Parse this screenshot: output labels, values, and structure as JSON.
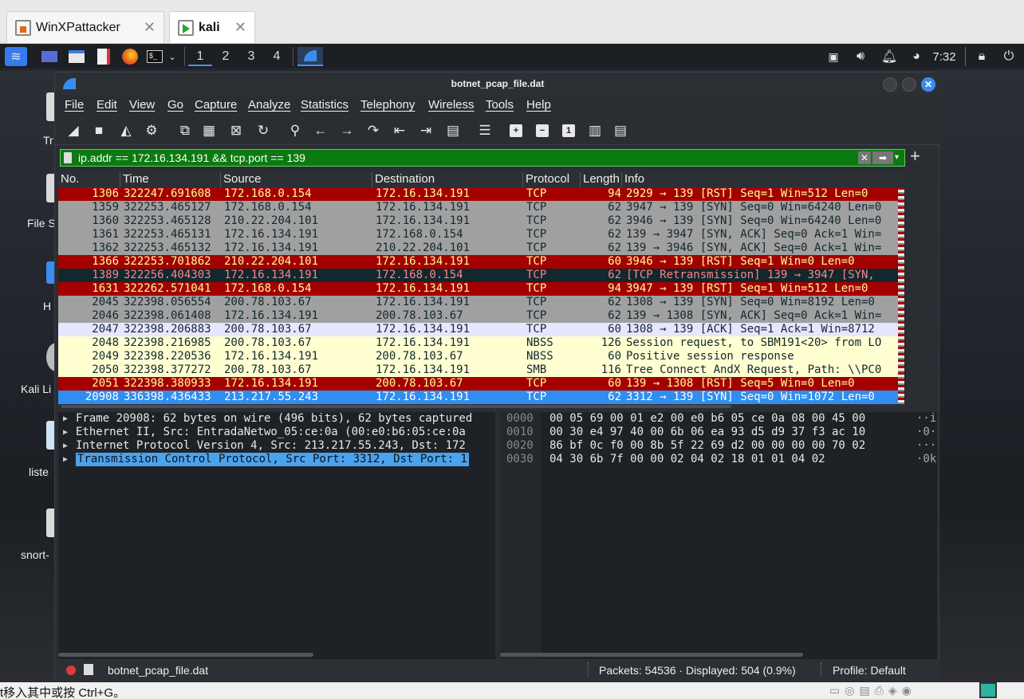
{
  "host_tabs": [
    {
      "label": "WinXPattacker",
      "bold": false
    },
    {
      "label": "kali",
      "bold": true
    }
  ],
  "panel": {
    "workspaces": [
      "1",
      "2",
      "3",
      "4"
    ],
    "active_workspace": "1",
    "clock": "7:32"
  },
  "desktop_icons": [
    {
      "label": "Tr"
    },
    {
      "label": "File S"
    },
    {
      "label": "H"
    },
    {
      "label": "Kali Li"
    },
    {
      "label": "liste"
    },
    {
      "label": "snort-"
    }
  ],
  "window": {
    "title": "botnet_pcap_file.dat",
    "menus": [
      "File",
      "Edit",
      "View",
      "Go",
      "Capture",
      "Analyze",
      "Statistics",
      "Telephony",
      "Wireless",
      "Tools",
      "Help"
    ],
    "filter": "ip.addr == 172.16.134.191 && tcp.port == 139",
    "columns": [
      "No.",
      "Time",
      "Source",
      "Destination",
      "Protocol",
      "Length",
      "Info"
    ],
    "packets": [
      {
        "no": "1306",
        "time": "322247.691608",
        "src": "172.168.0.154",
        "dst": "172.16.134.191",
        "proto": "TCP",
        "len": "94",
        "info": "2929 → 139 [RST] Seq=1 Win=512 Len=0",
        "style": "red"
      },
      {
        "no": "1359",
        "time": "322253.465127",
        "src": "172.168.0.154",
        "dst": "172.16.134.191",
        "proto": "TCP",
        "len": "62",
        "info": "3947 → 139 [SYN] Seq=0 Win=64240 Len=0",
        "style": "gray"
      },
      {
        "no": "1360",
        "time": "322253.465128",
        "src": "210.22.204.101",
        "dst": "172.16.134.191",
        "proto": "TCP",
        "len": "62",
        "info": "3946 → 139 [SYN] Seq=0 Win=64240 Len=0",
        "style": "gray"
      },
      {
        "no": "1361",
        "time": "322253.465131",
        "src": "172.16.134.191",
        "dst": "172.168.0.154",
        "proto": "TCP",
        "len": "62",
        "info": "139 → 3947 [SYN, ACK] Seq=0 Ack=1 Win=",
        "style": "gray"
      },
      {
        "no": "1362",
        "time": "322253.465132",
        "src": "172.16.134.191",
        "dst": "210.22.204.101",
        "proto": "TCP",
        "len": "62",
        "info": "139 → 3946 [SYN, ACK] Seq=0 Ack=1 Win=",
        "style": "gray"
      },
      {
        "no": "1366",
        "time": "322253.701862",
        "src": "210.22.204.101",
        "dst": "172.16.134.191",
        "proto": "TCP",
        "len": "60",
        "info": "3946 → 139 [RST] Seq=1 Win=0 Len=0",
        "style": "red"
      },
      {
        "no": "1389",
        "time": "322256.404303",
        "src": "172.16.134.191",
        "dst": "172.168.0.154",
        "proto": "TCP",
        "len": "62",
        "info": "[TCP Retransmission] 139 → 3947 [SYN,",
        "style": "dark"
      },
      {
        "no": "1631",
        "time": "322262.571041",
        "src": "172.168.0.154",
        "dst": "172.16.134.191",
        "proto": "TCP",
        "len": "94",
        "info": "3947 → 139 [RST] Seq=1 Win=512 Len=0",
        "style": "red"
      },
      {
        "no": "2045",
        "time": "322398.056554",
        "src": "200.78.103.67",
        "dst": "172.16.134.191",
        "proto": "TCP",
        "len": "62",
        "info": "1308 → 139 [SYN] Seq=0 Win=8192 Len=0",
        "style": "gray"
      },
      {
        "no": "2046",
        "time": "322398.061408",
        "src": "172.16.134.191",
        "dst": "200.78.103.67",
        "proto": "TCP",
        "len": "62",
        "info": "139 → 1308 [SYN, ACK] Seq=0 Ack=1 Win=",
        "style": "gray"
      },
      {
        "no": "2047",
        "time": "322398.206883",
        "src": "200.78.103.67",
        "dst": "172.16.134.191",
        "proto": "TCP",
        "len": "60",
        "info": "1308 → 139 [ACK] Seq=1 Ack=1 Win=8712",
        "style": "lav"
      },
      {
        "no": "2048",
        "time": "322398.216985",
        "src": "200.78.103.67",
        "dst": "172.16.134.191",
        "proto": "NBSS",
        "len": "126",
        "info": "Session request, to SBM191<20> from LO",
        "style": "yellow"
      },
      {
        "no": "2049",
        "time": "322398.220536",
        "src": "172.16.134.191",
        "dst": "200.78.103.67",
        "proto": "NBSS",
        "len": "60",
        "info": "Positive session response",
        "style": "yellow"
      },
      {
        "no": "2050",
        "time": "322398.377272",
        "src": "200.78.103.67",
        "dst": "172.16.134.191",
        "proto": "SMB",
        "len": "116",
        "info": "Tree Connect AndX Request, Path: \\\\PC0",
        "style": "yellow"
      },
      {
        "no": "2051",
        "time": "322398.380933",
        "src": "172.16.134.191",
        "dst": "200.78.103.67",
        "proto": "TCP",
        "len": "60",
        "info": "139 → 1308 [RST] Seq=5 Win=0 Len=0",
        "style": "red"
      },
      {
        "no": "20908",
        "time": "336398.436433",
        "src": "213.217.55.243",
        "dst": "172.16.134.191",
        "proto": "TCP",
        "len": "62",
        "info": "3312 → 139 [SYN] Seq=0 Win=1072 Len=0",
        "style": "selected"
      }
    ],
    "details": [
      {
        "text": "Frame 20908: 62 bytes on wire (496 bits), 62 bytes captured",
        "selected": false
      },
      {
        "text": "Ethernet II, Src: EntradaNetwo_05:ce:0a (00:e0:b6:05:ce:0a",
        "selected": false
      },
      {
        "text": "Internet Protocol Version 4, Src: 213.217.55.243, Dst: 172",
        "selected": false
      },
      {
        "text": "Transmission Control Protocol, Src Port: 3312, Dst Port: 1",
        "selected": true
      }
    ],
    "bytes": [
      {
        "off": "0000",
        "hex": "00 05 69 00 01 e2 00 e0  b6 05 ce 0a 08 00 45 00",
        "ascii": "··i"
      },
      {
        "off": "0010",
        "hex": "00 30 e4 97 40 00 6b 06  ea 93 d5 d9 37 f3 ac 10",
        "ascii": "·0·"
      },
      {
        "off": "0020",
        "hex": "86 bf 0c f0 00 8b 5f 22  69 d2 00 00 00 00 70 02",
        "ascii": "···"
      },
      {
        "off": "0030",
        "hex": "04 30 6b 7f 00 00 02 04  02 18 01 01 04 02",
        "ascii": "·0k"
      }
    ],
    "status": {
      "file": "botnet_pcap_file.dat",
      "packets": "Packets: 54536 · Displayed: 504 (0.9%)",
      "profile": "Profile: Default"
    }
  },
  "host_status_text": "t移入其中或按 Ctrl+G。",
  "colors": {
    "red_bg": "#a40000",
    "red_fg": "#fffc9c",
    "gray_bg": "#a0a0a0",
    "gray_fg": "#12272e",
    "dark_bg": "#12272e",
    "dark_fg": "#f78787",
    "lav_bg": "#e7e6ff",
    "lav_fg": "#12272e",
    "yellow_bg": "#ffffd2",
    "yellow_fg": "#12272e",
    "selected_bg": "#2f8ef0",
    "selected_fg": "#ffffff",
    "filter_bg": "#0b7a10",
    "close_button": "#3b8cf0"
  }
}
